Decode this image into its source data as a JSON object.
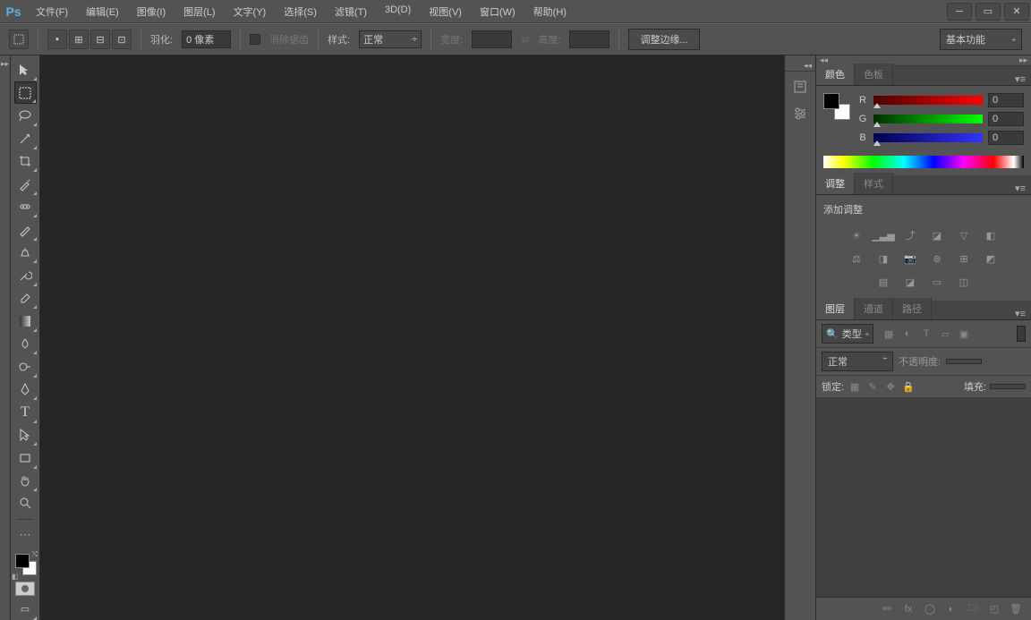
{
  "menu": {
    "file": "文件(F)",
    "edit": "编辑(E)",
    "image": "图像(I)",
    "layer": "图层(L)",
    "type": "文字(Y)",
    "select": "选择(S)",
    "filter": "滤镜(T)",
    "3d": "3D(D)",
    "view": "视图(V)",
    "window": "窗口(W)",
    "help": "帮助(H)"
  },
  "options": {
    "feather_label": "羽化:",
    "feather_value": "0 像素",
    "antialias_label": "消除锯齿",
    "style_label": "样式:",
    "style_value": "正常",
    "width_label": "宽度:",
    "height_label": "高度:",
    "refine_edge": "调整边缘...",
    "workspace": "基本功能"
  },
  "color_panel": {
    "tab_color": "颜色",
    "tab_swatches": "色板",
    "r_label": "R",
    "g_label": "G",
    "b_label": "B",
    "r_val": "0",
    "g_val": "0",
    "b_val": "0"
  },
  "adjustments": {
    "tab_adjust": "调整",
    "tab_styles": "样式",
    "add_label": "添加调整"
  },
  "layers": {
    "tab_layers": "图层",
    "tab_channels": "通道",
    "tab_paths": "路径",
    "filter_kind": "类型",
    "blend_mode": "正常",
    "opacity_label": "不透明度:",
    "lock_label": "锁定:",
    "fill_label": "填充:"
  }
}
